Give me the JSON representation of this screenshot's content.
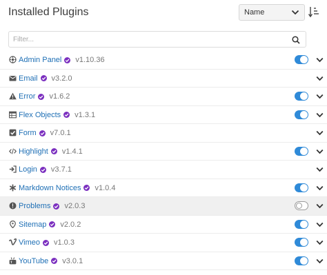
{
  "header": {
    "title": "Installed Plugins",
    "sort_value": "Name"
  },
  "filter": {
    "placeholder": "Filter...",
    "value": ""
  },
  "colors": {
    "link": "#1e6fb5",
    "toggle_on": "#2f8ad8",
    "badge": "#7b2fbf"
  },
  "plugins": [
    {
      "name": "Admin Panel",
      "version": "v1.10.36",
      "icon": "admin-icon",
      "enabled": true,
      "has_toggle": true
    },
    {
      "name": "Email",
      "version": "v3.2.0",
      "icon": "envelope-icon",
      "enabled": false,
      "has_toggle": false
    },
    {
      "name": "Error",
      "version": "v1.6.2",
      "icon": "warning-icon",
      "enabled": true,
      "has_toggle": true
    },
    {
      "name": "Flex Objects",
      "version": "v1.3.1",
      "icon": "table-icon",
      "enabled": true,
      "has_toggle": true
    },
    {
      "name": "Form",
      "version": "v7.0.1",
      "icon": "checkbox-icon",
      "enabled": false,
      "has_toggle": false
    },
    {
      "name": "Highlight",
      "version": "v1.4.1",
      "icon": "code-icon",
      "enabled": true,
      "has_toggle": true
    },
    {
      "name": "Login",
      "version": "v3.7.1",
      "icon": "sign-in-icon",
      "enabled": false,
      "has_toggle": false
    },
    {
      "name": "Markdown Notices",
      "version": "v1.0.4",
      "icon": "asterisk-icon",
      "enabled": true,
      "has_toggle": true
    },
    {
      "name": "Problems",
      "version": "v2.0.3",
      "icon": "exclamation-icon",
      "enabled": false,
      "has_toggle": true
    },
    {
      "name": "Sitemap",
      "version": "v2.0.2",
      "icon": "map-marker-icon",
      "enabled": true,
      "has_toggle": true
    },
    {
      "name": "Vimeo",
      "version": "v1.0.3",
      "icon": "vimeo-icon",
      "enabled": true,
      "has_toggle": true
    },
    {
      "name": "YouTube",
      "version": "v3.0.1",
      "icon": "youtube-icon",
      "enabled": true,
      "has_toggle": true
    }
  ]
}
